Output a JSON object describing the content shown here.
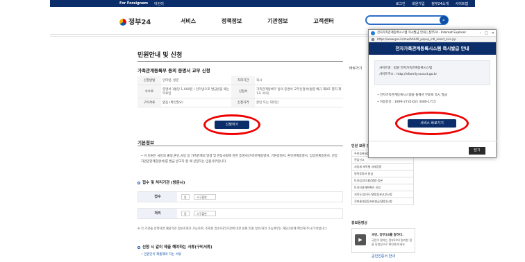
{
  "topbar": {
    "for_foreigners": "For Foreigners",
    "separator": "▾",
    "lang": "어린이",
    "links": [
      "로그인",
      "회원가입",
      "정부24소개",
      "사이트맵"
    ]
  },
  "header": {
    "logo": "정부24",
    "nav": [
      "서비스",
      "정책정보",
      "기관정보",
      "고객센터"
    ],
    "search_placeholder": "",
    "search_icon": "search-icon"
  },
  "main": {
    "title": "민원안내 및 신청",
    "subtitle": "가족관계등록부 등의 증명서 교부 신청",
    "info_rows": [
      {
        "k1": "신청방법",
        "v1": "인터넷, 방문",
        "k2": "처리기간",
        "v2": "즉시"
      },
      {
        "k1": "수수료",
        "v1": "증명서 1통당 1,000원 / 인터넷으로 발급받을 때는 무료임",
        "k2": "신청서",
        "v2": "가족관계등록부 등의 증명서 교부신청서(법령 예규 제8조 별지 제1호 서식)"
      },
      {
        "k1": "구비서류",
        "v1": "없음 (확인필요)",
        "k2": "신청자격",
        "v2": "본인 또는 대리인"
      }
    ],
    "apply_button": "신청하기",
    "basic_info_title": "기본정보",
    "basic_info_text": "• 이 민원은 국민의 출생,혼인,사망 등 가족관계의 발생 및 변동사항에 관한 증명서(가족관계증명서, 기본증명서, 혼인관계증명서, 입양관계증명서, 친양자입양관계증명서)를 발급 받고자 할 때 신청하는 민원사무입니다.",
    "receive_title": "접수 및 처리기관 (방문시)",
    "receive_label": "접수",
    "process_label": "처리",
    "field_do": "동",
    "field_sigungu": "시구출연",
    "note": "※ 각 기관을 선택하면 해당기관 정보조회가 가능하며, 조회된 접수/처리기관에 대한 실제 민원 접수/처리 가능여부는 해당기관에 확인해 주시기 바랍니다.",
    "docs_title": "신청 시 같이 제출 해야하는 서류(구비서류)",
    "docs_link": "• 민원인이 제출해야 하는 서류"
  },
  "right": {
    "quick_label": "바로가기",
    "related_title": "민원 보류 안내",
    "related_items": [
      "주민등록표등본 발급",
      "전입신고",
      "지방세 세목별 과세증명",
      "병적증명서 발급",
      "토지(임야)대장열람·등본",
      "토지이용계획확인 신청",
      "지적도(임야도)열람등본교부신청",
      "건축물대장등초본발급(열람)신청"
    ],
    "promo_title": "홍보동영상",
    "promo_head": "국민, 정부24를 말하다.",
    "promo_desc": "국민이 말하는 정부24의 편리한 점을 동영상으로 확인해 보세요.",
    "stamp_text": "공인인증서 안내"
  },
  "popup": {
    "window_title": "전자가족관계등록시스템 즉시발급 안내 | 정부24 - Internet Explorer",
    "url": "https://www.gov.kr/mw/AA040_popup_intl_select_kiss.jsp",
    "heading": "전자가족관계등록시스템 즉시발급 안내",
    "site_name": "사이트명 : 법원 전자가족관계등록시스템",
    "site_url": "사이트주소 : http://efamily.scourt.go.kr",
    "desc1": "• 전자가족관계등록시스템을 통해서 무료로 즉시 발급",
    "desc2": "• 이용문의 : 1899-2732(02) 3480-1715",
    "service_button": "서비스 바로가기",
    "close_button": "닫기"
  }
}
